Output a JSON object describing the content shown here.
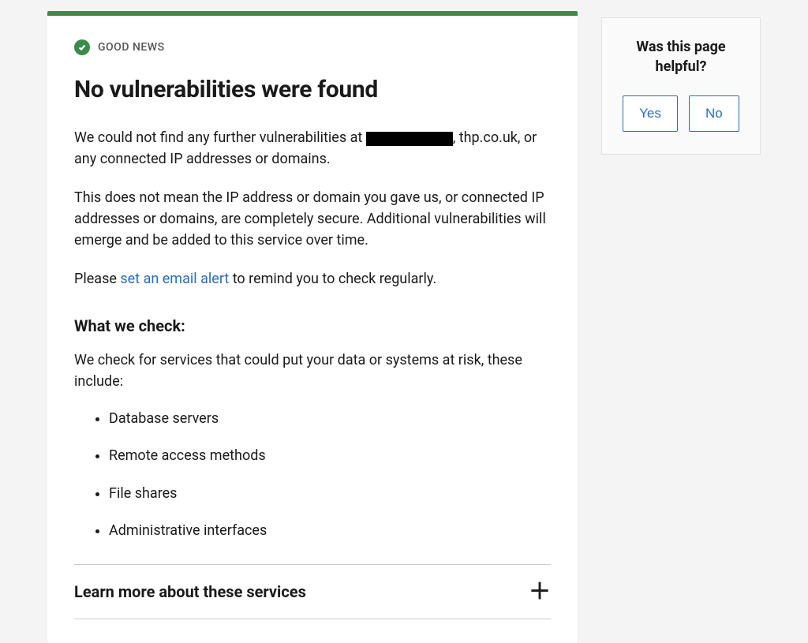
{
  "badge": {
    "label": "GOOD NEWS"
  },
  "main": {
    "title": "No vulnerabilities were found",
    "para1_prefix": "We could not find any further vulnerabilities at ",
    "para1_suffix": ", thp.co.uk, or any connected IP addresses or domains.",
    "para2": "This does not mean the IP address or domain you gave us, or connected IP addresses or domains, are completely secure. Additional vulnerabilities will emerge and be added to this service over time.",
    "para3_prefix": "Please ",
    "alert_link": "set an email alert",
    "para3_suffix": " to remind you to check regularly.",
    "check_heading": "What we check:",
    "check_intro": "We check for services that could put your data or systems at risk, these include:",
    "check_items": [
      "Database servers",
      "Remote access methods",
      "File shares",
      "Administrative interfaces"
    ],
    "accordion_title": "Learn more about these services"
  },
  "sidebar": {
    "title": "Was this page helpful?",
    "yes_label": "Yes",
    "no_label": "No"
  },
  "colors": {
    "accent_green": "#3a8b4a",
    "link_blue": "#2a6db8"
  }
}
